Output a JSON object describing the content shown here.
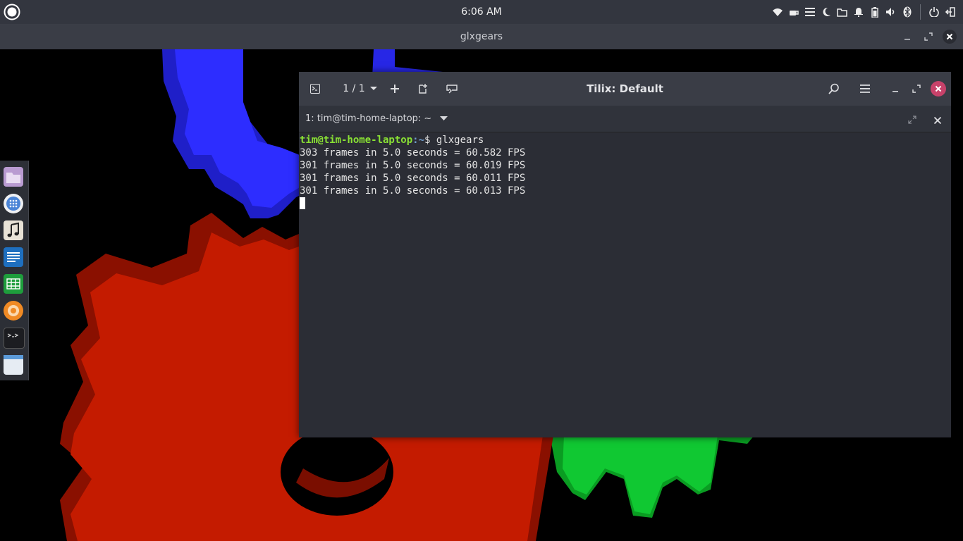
{
  "top_panel": {
    "clock": "6:06 AM",
    "tray_icons": [
      "wifi-icon",
      "coffee-icon",
      "menu-lines-icon",
      "night-light-icon",
      "files-icon",
      "notification-bell-icon",
      "battery-icon",
      "volume-icon",
      "bluetooth-icon",
      "power-icon",
      "logout-icon"
    ]
  },
  "gl_window": {
    "title": "glxgears"
  },
  "dock": {
    "apps": [
      "files",
      "app-grid",
      "music",
      "writer",
      "calc",
      "firefox",
      "terminal",
      "window"
    ]
  },
  "tilix": {
    "title": "Tilix: Default",
    "session_count": "1 / 1",
    "tab_label": "1: tim@tim-home-laptop: ~",
    "terminal": {
      "prompt_user": "tim@tim-home-laptop",
      "prompt_sep": ":",
      "prompt_path": "~",
      "prompt_tail": "$ glxgears",
      "lines": [
        "303 frames in 5.0 seconds = 60.582 FPS",
        "301 frames in 5.0 seconds = 60.019 FPS",
        "301 frames in 5.0 seconds = 60.011 FPS",
        "301 frames in 5.0 seconds = 60.013 FPS"
      ]
    }
  },
  "colors": {
    "red_gear": "#c31a00",
    "blue_gear": "#2b2bff",
    "green_gear": "#0fc62f",
    "close_accent": "#c7426a"
  }
}
